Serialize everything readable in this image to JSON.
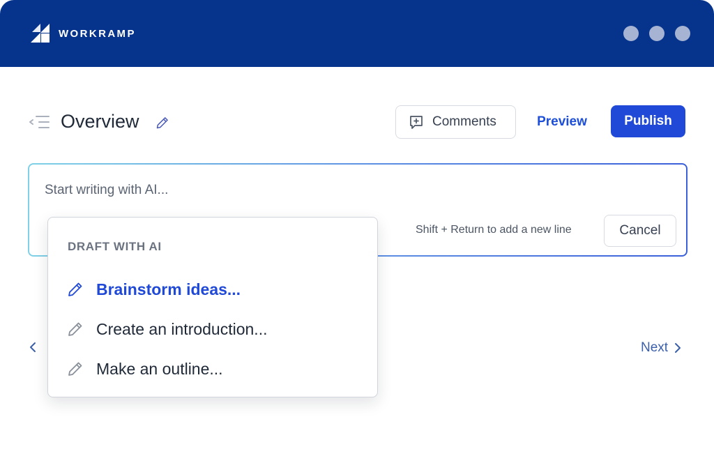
{
  "brand": {
    "name": "WORKRAMP",
    "primary_color": "#06348c",
    "accent_color": "#1f49d6"
  },
  "window_controls": [
    "dot",
    "dot",
    "dot"
  ],
  "header": {
    "title": "Overview",
    "comments_label": "Comments",
    "preview_label": "Preview",
    "publish_label": "Publish"
  },
  "ai_prompt": {
    "placeholder": "Start writing with AI...",
    "value": "",
    "hint": "Shift + Return to add a new line",
    "cancel_label": "Cancel"
  },
  "draft_menu": {
    "heading": "DRAFT WITH AI",
    "items": [
      {
        "label": "Brainstorm ideas...",
        "icon": "pencil-icon",
        "active": true
      },
      {
        "label": "Create an introduction...",
        "icon": "pencil-icon",
        "active": false
      },
      {
        "label": "Make an outline...",
        "icon": "pencil-icon",
        "active": false
      }
    ]
  },
  "navigation": {
    "next_label": "Next"
  }
}
